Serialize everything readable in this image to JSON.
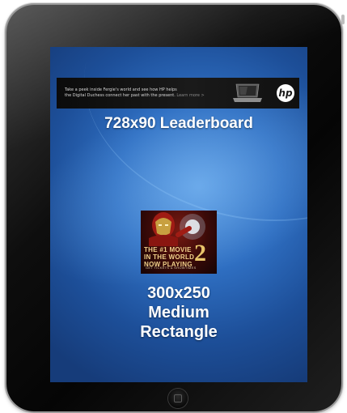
{
  "leaderboard": {
    "label": "728x90 Leaderboard",
    "ad_text_line1": "Take a peek inside Fergie's world and see how HP helps",
    "ad_text_line2": "the Digital Duchess connect her past with the present.",
    "ad_link": "Learn more >",
    "logo": "hp"
  },
  "medium_rectangle": {
    "label_line1": "300x250",
    "label_line2": "Medium",
    "label_line3": "Rectangle",
    "ad_headline_line1": "THE #1 MOVIE",
    "ad_headline_line2": "IN THE WORLD",
    "ad_headline_line3": "NOW PLAYING",
    "ad_number": "2",
    "ad_cta": "GET TICKETS & SHOWTIMES"
  },
  "colors": {
    "screen_blue": "#2f6fc2",
    "bezel": "#0e0e0e",
    "movie_gold": "#e8c46a"
  },
  "icons": {
    "home_button": "home-button-icon",
    "laptop": "laptop-icon",
    "hp_logo": "hp-logo-icon"
  }
}
